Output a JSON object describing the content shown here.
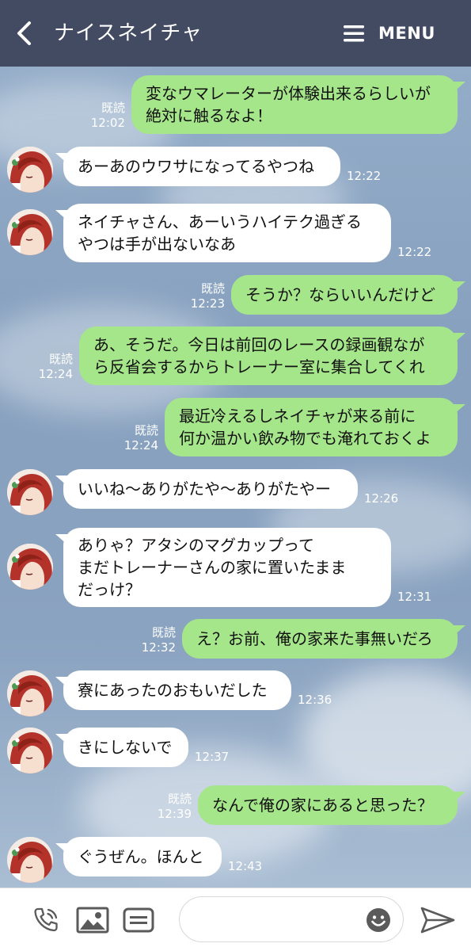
{
  "header": {
    "title": "ナイスネイチャ",
    "menu_label": "MENU",
    "bg_color": "#434b62"
  },
  "messages": [
    {
      "side": "out",
      "lines": [
        "変なウマレーターが体験出来るらしいが",
        "絶対に触るなよ！"
      ],
      "read": "既読",
      "time": "12:02"
    },
    {
      "side": "in",
      "lines": [
        "あーあのウワサになってるやつね"
      ],
      "time": "12:22"
    },
    {
      "side": "in",
      "lines": [
        "ネイチャさん、あーいうハイテク過ぎる",
        "やつは手が出ないなあ"
      ],
      "time": "12:22"
    },
    {
      "side": "out",
      "lines": [
        "そうか？ならいいんだけど"
      ],
      "read": "既読",
      "time": "12:23"
    },
    {
      "side": "out",
      "lines": [
        "あ、そうだ。今日は前回のレースの録画観なが",
        "ら反省会するからトレーナー室に集合してくれ"
      ],
      "read": "既読",
      "time": "12:24"
    },
    {
      "side": "out",
      "lines": [
        "最近冷えるしネイチャが来る前に",
        "何か温かい飲み物でも淹れておくよ"
      ],
      "read": "既読",
      "time": "12:24"
    },
    {
      "side": "in",
      "lines": [
        "いいね〜ありがたや〜ありがたやー"
      ],
      "time": "12:26"
    },
    {
      "side": "in",
      "lines": [
        "ありゃ？アタシのマグカップって",
        "まだトレーナーさんの家に置いたまま",
        "だっけ？"
      ],
      "time": "12:31"
    },
    {
      "side": "out",
      "lines": [
        "え？お前、俺の家来た事無いだろ"
      ],
      "read": "既読",
      "time": "12:32"
    },
    {
      "side": "in",
      "lines": [
        "寮にあったのおもいだした"
      ],
      "time": "12:36"
    },
    {
      "side": "in",
      "lines": [
        "きにしないで"
      ],
      "time": "12:37"
    },
    {
      "side": "out",
      "lines": [
        "なんで俺の家にあると思った？"
      ],
      "read": "既読",
      "time": "12:39"
    },
    {
      "side": "in",
      "lines": [
        "ぐうぜん。ほんと"
      ],
      "time": "12:43"
    }
  ],
  "bottom_bar": {
    "call_icon": "phone-icon",
    "image_icon": "image-icon",
    "note_icon": "note-icon",
    "emoji_icon": "smiley-icon",
    "send_icon": "send-icon",
    "input_value": "",
    "input_placeholder": ""
  },
  "colors": {
    "outgoing_bubble": "#a6e68a",
    "incoming_bubble": "#ffffff",
    "chat_background": "#8aa3c0"
  }
}
